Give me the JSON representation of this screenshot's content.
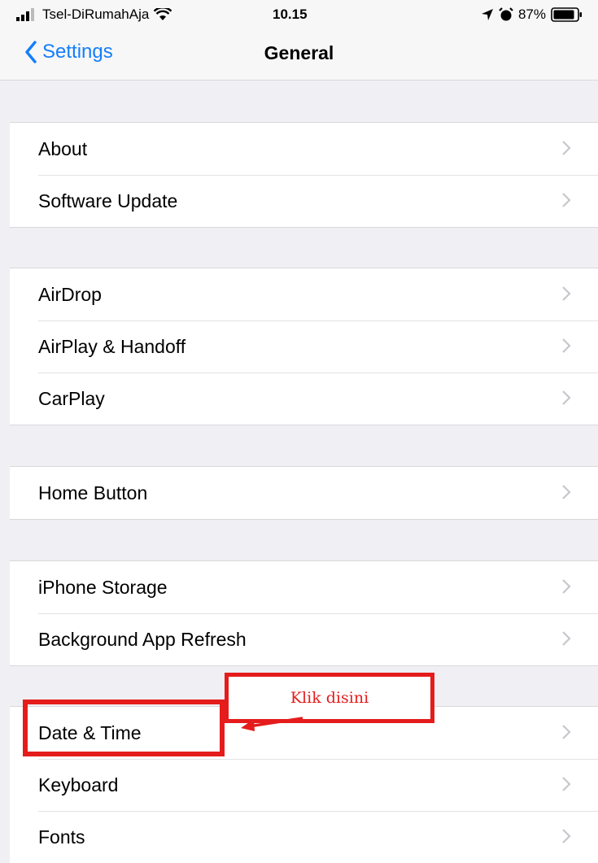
{
  "status_bar": {
    "carrier": "Tsel-DiRumahAja",
    "time": "10.15",
    "battery": "87%",
    "icons": [
      "signal-icon",
      "wifi-icon",
      "location-icon",
      "alarm-icon",
      "battery-icon"
    ]
  },
  "nav": {
    "back_label": "Settings",
    "title": "General"
  },
  "groups": [
    {
      "items": [
        {
          "label": "About"
        },
        {
          "label": "Software Update"
        }
      ]
    },
    {
      "items": [
        {
          "label": "AirDrop"
        },
        {
          "label": "AirPlay & Handoff"
        },
        {
          "label": "CarPlay"
        }
      ]
    },
    {
      "items": [
        {
          "label": "Home Button"
        }
      ]
    },
    {
      "items": [
        {
          "label": "iPhone Storage"
        },
        {
          "label": "Background App Refresh"
        }
      ]
    },
    {
      "items": [
        {
          "label": "Date & Time"
        },
        {
          "label": "Keyboard"
        },
        {
          "label": "Fonts"
        }
      ]
    }
  ],
  "annotation": {
    "note": "Klik disini",
    "color": "#e51c1c"
  },
  "colors": {
    "accent": "#147efb",
    "background": "#efeff4",
    "chevron": "#c7c7cc"
  }
}
